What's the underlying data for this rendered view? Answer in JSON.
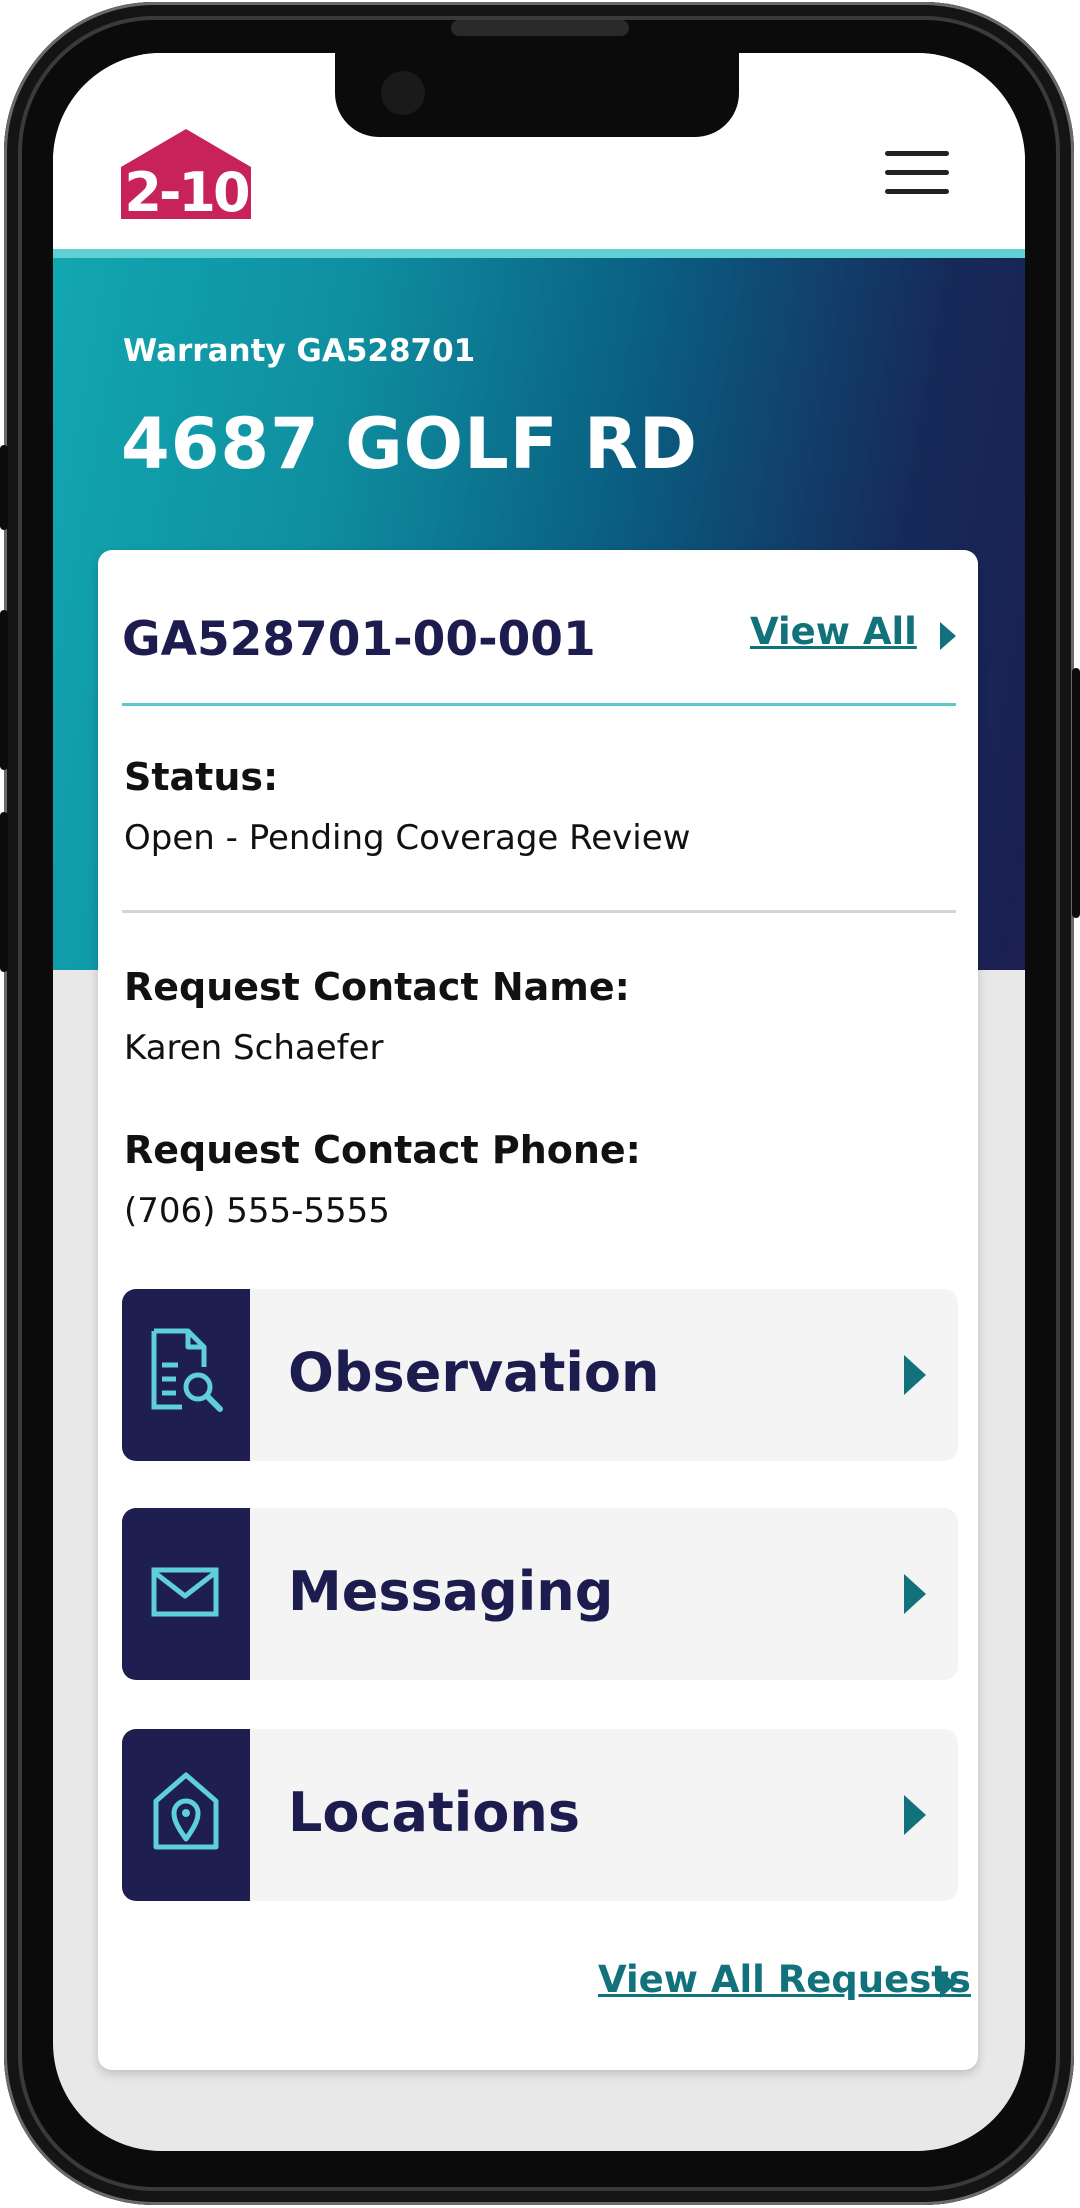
{
  "header": {
    "logo_text": "2-10",
    "logo_icon": "house-logo-icon",
    "menu_icon": "hamburger-menu-icon"
  },
  "hero": {
    "warranty_label": "Warranty GA528701",
    "address": "4687 GOLF RD"
  },
  "request": {
    "id": "GA528701-00-001",
    "view_all_label": "View All",
    "status_label": "Status:",
    "status_value": "Open - Pending Coverage Review",
    "contact_name_label": "Request Contact Name:",
    "contact_name_value": "Karen Schaefer",
    "contact_phone_label": "Request Contact Phone:",
    "contact_phone_value": "(706) 555-5555"
  },
  "actions": [
    {
      "label": "Observation",
      "icon": "document-search-icon"
    },
    {
      "label": "Messaging",
      "icon": "envelope-icon"
    },
    {
      "label": "Locations",
      "icon": "house-pin-icon"
    }
  ],
  "footer": {
    "view_all_requests_label": "View All Requests"
  },
  "colors": {
    "brand_pink": "#c8225a",
    "navy": "#1c1c4f",
    "teal": "#11727b",
    "accent_line": "#5fcfd3",
    "icon_cyan": "#5fcfd8"
  }
}
